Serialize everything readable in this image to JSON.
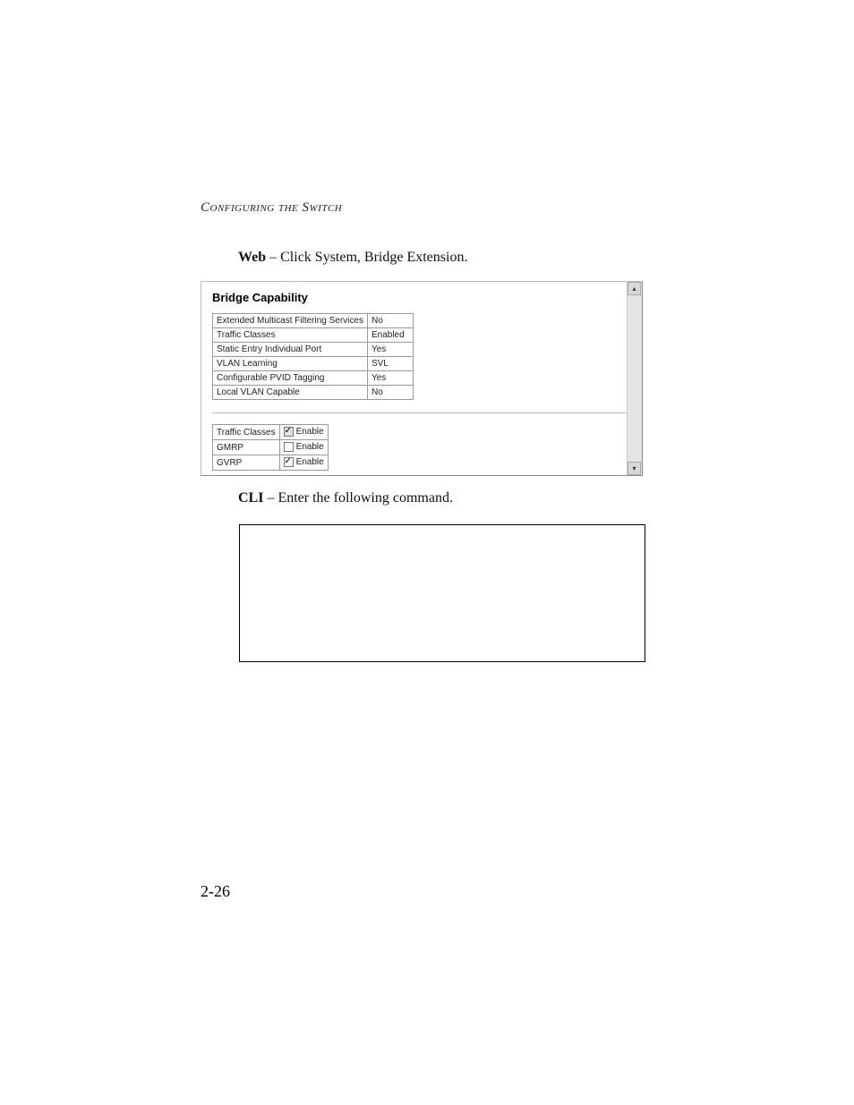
{
  "running_head": "Configuring the Switch",
  "web_label": "Web",
  "web_rest": " – Click System, Bridge Extension.",
  "cli_label": "CLI",
  "cli_rest": " – Enter the following command.",
  "screenshot": {
    "title": "Bridge Capability",
    "rows": [
      {
        "k": "Extended Multicast Filtering Services",
        "v": "No"
      },
      {
        "k": "Traffic Classes",
        "v": "Enabled"
      },
      {
        "k": "Static Entry Individual Port",
        "v": "Yes"
      },
      {
        "k": "VLAN Learning",
        "v": "SVL"
      },
      {
        "k": "Configurable PVID Tagging",
        "v": "Yes"
      },
      {
        "k": "Local VLAN Capable",
        "v": "No"
      }
    ],
    "config": [
      {
        "k": "Traffic Classes",
        "label": "Enable",
        "checked": true,
        "grey": true
      },
      {
        "k": "GMRP",
        "label": "Enable",
        "checked": false,
        "grey": false
      },
      {
        "k": "GVRP",
        "label": "Enable",
        "checked": true,
        "grey": false
      }
    ],
    "scroll_up_glyph": "▴",
    "scroll_down_glyph": "▾"
  },
  "page_number": "2-26"
}
